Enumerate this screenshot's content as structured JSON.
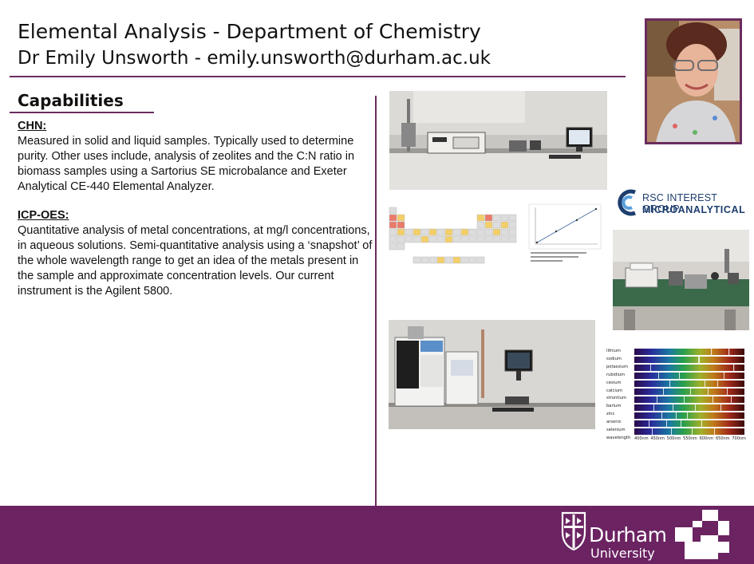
{
  "header": {
    "title": "Elemental Analysis - Department of Chemistry",
    "subtitle": "Dr Emily Unsworth - emily.unsworth@durham.ac.uk"
  },
  "capabilities": {
    "heading": "Capabilities",
    "chn": {
      "title": "CHN:",
      "text": "Measured in solid and liquid samples. Typically used to determine purity. Other uses include, analysis of zeolites and the C:N ratio in biomass samples using a Sartorius SE microbalance and Exeter Analytical CE-440 Elemental Analyzer."
    },
    "icp": {
      "title": "ICP-OES:",
      "text": "Quantitative analysis of metal concentrations, at mg/l concentrations, in aqueous solutions. Semi-quantitative analysis using a ‘snapshot’ of the whole wavelength range to get an idea of the metals present in the sample and approximate concentration levels. Our current instrument is the Agilent 5800."
    }
  },
  "rsc_logo": {
    "line1": "RSC INTEREST GROUP",
    "line2": "MICROANALYTICAL"
  },
  "spectra": {
    "elements": [
      "lithium",
      "sodium",
      "potassium",
      "rubidium",
      "cesium",
      "calcium",
      "strontium",
      "barium",
      "zinc",
      "arsenic",
      "selenium"
    ],
    "axis_label": "wavelength",
    "ticks": [
      "400nm",
      "450nm",
      "500nm",
      "550nm",
      "600nm",
      "650nm",
      "700nm"
    ]
  },
  "footer": {
    "university_word": "Durham",
    "university_sub": "University"
  },
  "colors": {
    "accent": "#6b2c5e",
    "footer": "#6b2362",
    "rsc_blue": "#1d3e6e"
  }
}
